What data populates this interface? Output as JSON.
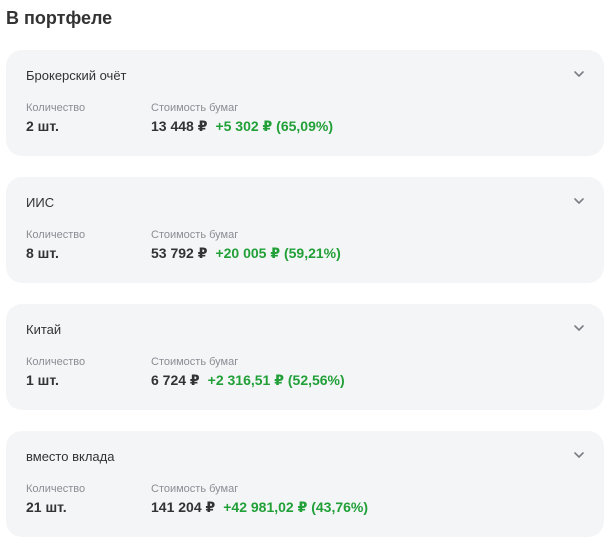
{
  "section_title": "В портфеле",
  "labels": {
    "quantity": "Количество",
    "value": "Стоимость бумаг"
  },
  "colors": {
    "gain": "#21a038",
    "card_background": "#f4f5f7",
    "text": "#333333",
    "muted": "#8a8d93"
  },
  "icons": {
    "expand": "chevron-down-icon"
  },
  "accounts": [
    {
      "name": "Брокерский очёт",
      "quantity": "2 шт.",
      "value": "13 448 ₽",
      "gain": "+5 302 ₽ (65,09%)"
    },
    {
      "name": "ИИС",
      "quantity": "8 шт.",
      "value": "53 792 ₽",
      "gain": "+20 005 ₽ (59,21%)"
    },
    {
      "name": "Китай",
      "quantity": "1 шт.",
      "value": "6 724 ₽",
      "gain": "+2 316,51 ₽ (52,56%)"
    },
    {
      "name": "вместо вклада",
      "quantity": "21 шт.",
      "value": "141 204 ₽",
      "gain": "+42 981,02 ₽ (43,76%)"
    }
  ]
}
